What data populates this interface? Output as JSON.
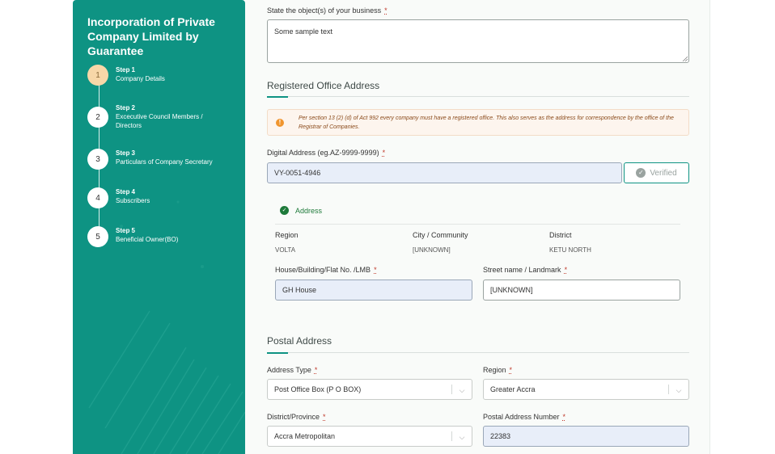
{
  "sidebar": {
    "title": "Incorporation of Private Company Limited by Guarantee",
    "steps": [
      {
        "num": "1",
        "step": "Step 1",
        "label": "Company Details",
        "active": true
      },
      {
        "num": "2",
        "step": "Step 2",
        "label": "Excecutive Council Members / Directors",
        "active": false
      },
      {
        "num": "3",
        "step": "Step 3",
        "label": "Particulars of Company Secretary",
        "active": false
      },
      {
        "num": "4",
        "step": "Step 4",
        "label": "Subscribers",
        "active": false
      },
      {
        "num": "5",
        "step": "Step 5",
        "label": "Beneficial Owner(BO)",
        "active": false
      }
    ]
  },
  "form": {
    "objects_label": "State the object(s) of your business",
    "objects_value": "Some sample text",
    "required_mark": "*",
    "registered_office": {
      "title": "Registered Office Address",
      "notice": "Per section 13 (2) (d) of Act 992 every company must have a registered office. This also serves as the address for correspondence by the office of the Registrar of Companies.",
      "notice_icon": "!",
      "digital_address_label": "Digital Address (eg.AZ-9999-9999)",
      "digital_address_value": "VY-0051-4946",
      "verified_label": "Verified",
      "address_heading": "Address",
      "region_label": "Region",
      "region_value": "VOLTA",
      "city_label": "City / Community",
      "city_value": "[UNKNOWN]",
      "district_label": "District",
      "district_value": "KETU NORTH",
      "house_label": "House/Building/Flat No. /LMB",
      "house_value": "GH House",
      "street_label": "Street name / Landmark",
      "street_value": "[UNKNOWN]"
    },
    "postal": {
      "title": "Postal Address",
      "address_type_label": "Address Type",
      "address_type_value": "Post Office Box (P O BOX)",
      "region_label": "Region",
      "region_value": "Greater Accra",
      "district_label": "District/Province",
      "district_value": "Accra Metropolitan",
      "number_label": "Postal Address Number",
      "number_value": "22383"
    }
  },
  "colors": {
    "sidebar": "#0e9383",
    "active_step": "#f7d7a8",
    "verified_border": "#0e9383",
    "address_ok": "#1e7a3a",
    "notice_bg": "#fdf5ee"
  }
}
